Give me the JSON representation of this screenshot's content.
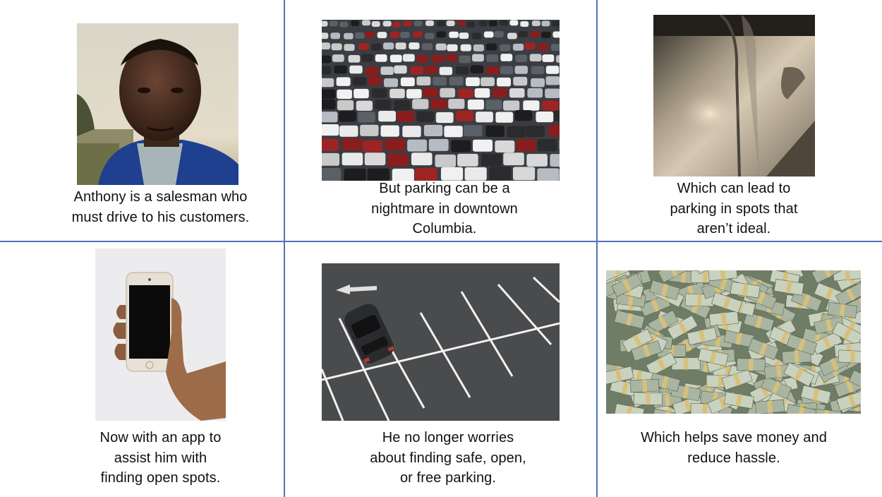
{
  "panels": [
    {
      "id": "anthony",
      "image": "portrait-of-older-man",
      "caption": [
        "Anthony is a salesman who",
        "must drive to his customers."
      ]
    },
    {
      "id": "crowded-lot",
      "image": "crowded-parking-lot",
      "caption": [
        "But parking can be a",
        "nightmare in downtown",
        "Columbia."
      ]
    },
    {
      "id": "dented-car",
      "image": "dented-car-door",
      "caption": [
        "Which can lead to",
        "parking in spots that",
        "aren’t ideal."
      ]
    },
    {
      "id": "app",
      "image": "hand-holding-phone",
      "caption": [
        "Now with an app to",
        "assist him with",
        "finding open spots."
      ]
    },
    {
      "id": "open-lot",
      "image": "car-in-empty-lot",
      "caption": [
        "He no longer worries",
        "about finding safe, open,",
        "or free parking."
      ]
    },
    {
      "id": "money",
      "image": "pile-of-cash",
      "caption": [
        "Which helps save money and",
        "reduce hassle."
      ]
    }
  ],
  "colors": {
    "divider": "#4f72b8"
  }
}
